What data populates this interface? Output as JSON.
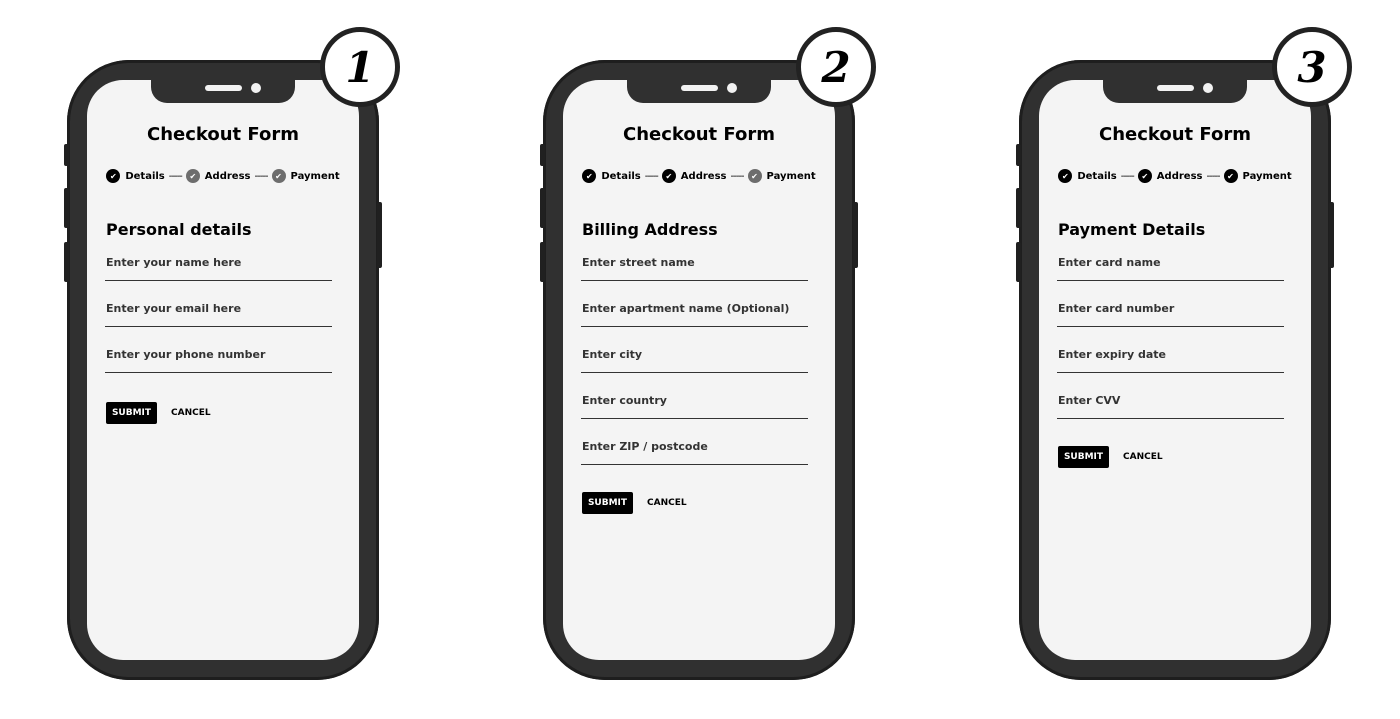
{
  "phones": [
    {
      "badge": "1",
      "title": "Checkout Form",
      "steps": [
        {
          "label": "Details",
          "state": "done"
        },
        {
          "label": "Address",
          "state": "pending"
        },
        {
          "label": "Payment",
          "state": "pending"
        }
      ],
      "step_separator": "-----",
      "section_title": "Personal details",
      "fields": [
        {
          "placeholder": "Enter your name here"
        },
        {
          "placeholder": "Enter your email here"
        },
        {
          "placeholder": "Enter your phone number"
        }
      ],
      "submit_label": "SUBMIT",
      "cancel_label": "CANCEL"
    },
    {
      "badge": "2",
      "title": "Checkout Form",
      "steps": [
        {
          "label": "Details",
          "state": "done"
        },
        {
          "label": "Address",
          "state": "done"
        },
        {
          "label": "Payment",
          "state": "pending"
        }
      ],
      "step_separator": "-----",
      "section_title": "Billing Address",
      "fields": [
        {
          "placeholder": "Enter street name"
        },
        {
          "placeholder": "Enter apartment name (Optional)"
        },
        {
          "placeholder": "Enter city"
        },
        {
          "placeholder": "Enter country"
        },
        {
          "placeholder": "Enter ZIP / postcode"
        }
      ],
      "submit_label": "SUBMIT",
      "cancel_label": "CANCEL"
    },
    {
      "badge": "3",
      "title": "Checkout Form",
      "steps": [
        {
          "label": "Details",
          "state": "done"
        },
        {
          "label": "Address",
          "state": "done"
        },
        {
          "label": "Payment",
          "state": "done"
        }
      ],
      "step_separator": "-----",
      "section_title": "Payment Details",
      "fields": [
        {
          "placeholder": "Enter card name"
        },
        {
          "placeholder": "Enter card number"
        },
        {
          "placeholder": "Enter expiry date"
        },
        {
          "placeholder": "Enter CVV"
        }
      ],
      "submit_label": "SUBMIT",
      "cancel_label": "CANCEL"
    }
  ],
  "colors": {
    "phone_body": "#303030",
    "screen_bg": "#f4f4f4",
    "step_done": "#000000",
    "step_pending": "#6d6d6d",
    "submit_bg": "#000000"
  },
  "icons": {
    "check": "check-icon"
  }
}
